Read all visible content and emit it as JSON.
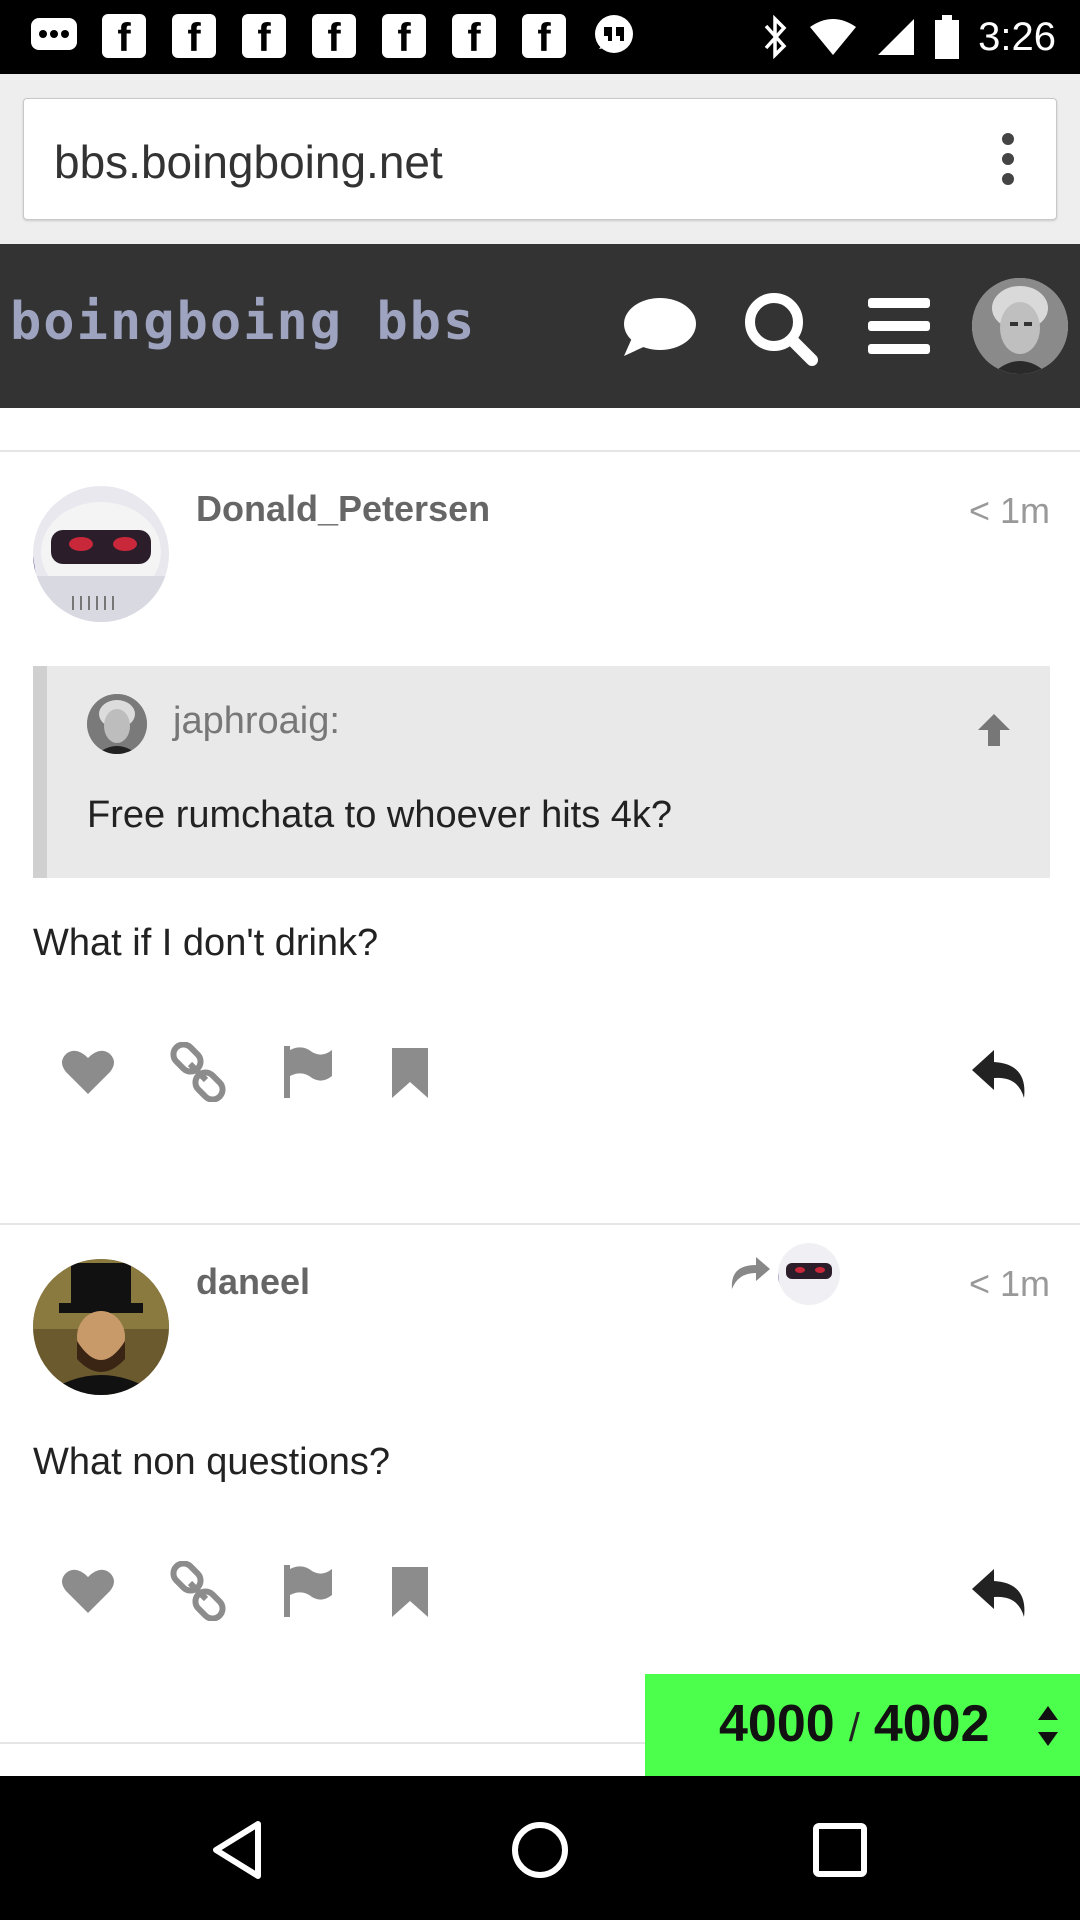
{
  "status_bar": {
    "time": "3:26",
    "notification_icons": [
      "chat-icon",
      "facebook-icon",
      "facebook-icon",
      "facebook-icon",
      "facebook-icon",
      "facebook-icon",
      "facebook-icon",
      "facebook-icon",
      "quote-notification-icon"
    ],
    "system_icons": [
      "bluetooth-icon",
      "wifi-icon",
      "cell-signal-icon",
      "battery-icon"
    ]
  },
  "browser": {
    "url": "bbs.boingboing.net",
    "menu_icon": "overflow-menu-icon"
  },
  "site_header": {
    "logo": "boingboing bbs",
    "icons": [
      "chat-bubble-icon",
      "search-icon",
      "hamburger-menu-icon",
      "user-avatar"
    ]
  },
  "posts": [
    {
      "username": "Donald_Petersen",
      "time": "< 1m",
      "quote": {
        "username": "japhroaig:",
        "text": "Free rumchata to whoever hits 4k?"
      },
      "body": "What if I don't drink?"
    },
    {
      "username": "daneel",
      "time": "< 1m",
      "reply_to_icon": "reply-to-icon",
      "body": "What non questions?"
    }
  ],
  "actions": [
    "heart-icon",
    "link-icon",
    "flag-icon",
    "bookmark-icon",
    "reply-icon"
  ],
  "progress": {
    "current": "4000",
    "separator": "/",
    "total": "4002",
    "color": "#4cff4c"
  },
  "nav_bar": [
    "back-icon",
    "home-icon",
    "recents-icon"
  ]
}
